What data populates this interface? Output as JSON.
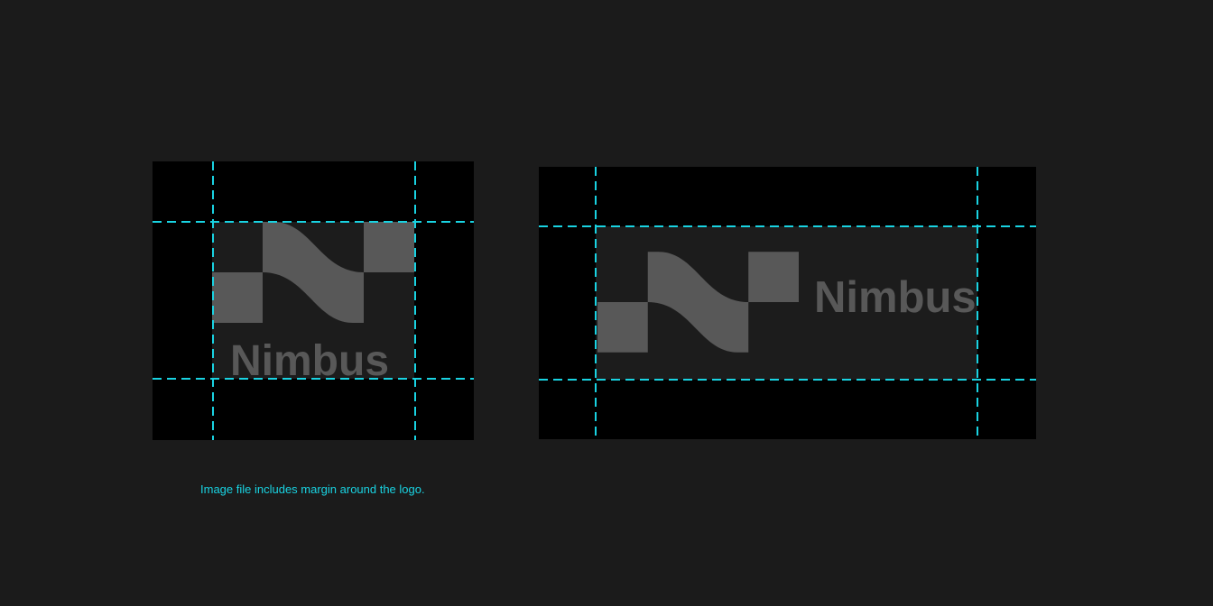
{
  "colors": {
    "background": "#1b1b1b",
    "panel": "#000000",
    "logo_area": "#1c1c1c",
    "logo": "#585858",
    "guide": "#19d3e2"
  },
  "logos": {
    "vertical": {
      "wordmark": "Nimbus"
    },
    "horizontal": {
      "wordmark": "Nimbus"
    }
  },
  "caption": "Image file includes margin around the logo."
}
